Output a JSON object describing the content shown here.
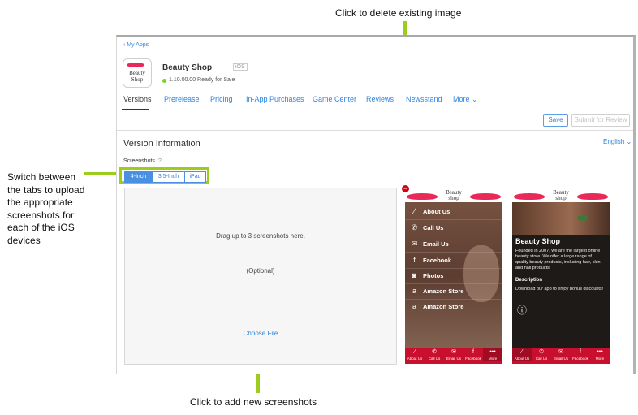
{
  "callouts": {
    "delete": "Click to delete existing image",
    "switch_tabs": [
      "Switch between",
      "the tabs to upload",
      "the appropriate",
      "screenshots for",
      "each of the iOS",
      "devices"
    ],
    "add": "Click to add new screenshots"
  },
  "header": {
    "back_link": "My Apps",
    "app_name": "Beauty Shop",
    "platform_badge": "iOS",
    "status": "1.10.00.00 Ready for Sale",
    "app_icon_text": [
      "Beauty",
      "Shop"
    ]
  },
  "tabs": [
    "Versions",
    "Prerelease",
    "Pricing",
    "In-App Purchases",
    "Game Center",
    "Reviews",
    "Newsstand",
    "More"
  ],
  "more_chevron": "⌄",
  "toolbar": {
    "save": "Save",
    "submit": "Submit for Review"
  },
  "section": {
    "title": "Version Information",
    "language": "English",
    "language_chevron": "⌄",
    "screenshots_label": "Screenshots",
    "help_icon": "?"
  },
  "devices": [
    "4-Inch",
    "3.5-Inch",
    "iPad"
  ],
  "dropzone": {
    "hint": "Drag up to 3 screenshots here.",
    "optional": "(Optional)",
    "choose": "Choose File"
  },
  "phone1": {
    "logo": [
      "Beauty",
      "shop"
    ],
    "menu": [
      {
        "icon": "brush-icon",
        "glyph": "⁄",
        "label": "About Us"
      },
      {
        "icon": "phone-icon",
        "glyph": "✆",
        "label": "Call Us"
      },
      {
        "icon": "envelope-icon",
        "glyph": "✉",
        "label": "Email Us"
      },
      {
        "icon": "facebook-icon",
        "glyph": "f",
        "label": "Facebook"
      },
      {
        "icon": "camera-icon",
        "glyph": "◙",
        "label": "Photos"
      },
      {
        "icon": "amazon-icon",
        "glyph": "a",
        "label": "Amazon Store"
      },
      {
        "icon": "amazon-icon",
        "glyph": "a",
        "label": "Amazon Store"
      }
    ],
    "bar": [
      {
        "glyph": "⁄",
        "label": "About Us"
      },
      {
        "glyph": "✆",
        "label": "Call Us"
      },
      {
        "glyph": "✉",
        "label": "Email Us"
      },
      {
        "glyph": "f",
        "label": "Facebook"
      },
      {
        "glyph": "•••",
        "label": "More"
      }
    ]
  },
  "phone2": {
    "logo": [
      "Beauty",
      "shop"
    ],
    "title": "Beauty Shop",
    "body": "Founded in 2007, we are the largest online beauty store. We offer a large range of quality beauty products, including hair, skin and nail products.",
    "desc_heading": "Description",
    "desc": "Download our app to enjoy bonus discounts!",
    "info_glyph": "ⓘ",
    "bar": [
      {
        "glyph": "⁄",
        "label": "About Us"
      },
      {
        "glyph": "✆",
        "label": "Call Us"
      },
      {
        "glyph": "✉",
        "label": "Email Us"
      },
      {
        "glyph": "f",
        "label": "Facebook"
      },
      {
        "glyph": "•••",
        "label": "More"
      }
    ]
  },
  "delete_glyph": "−",
  "colors": {
    "accent": "#4a90e2",
    "callout": "#9ccc1e",
    "brand_red": "#c8102e",
    "status_green": "#7ed321"
  }
}
